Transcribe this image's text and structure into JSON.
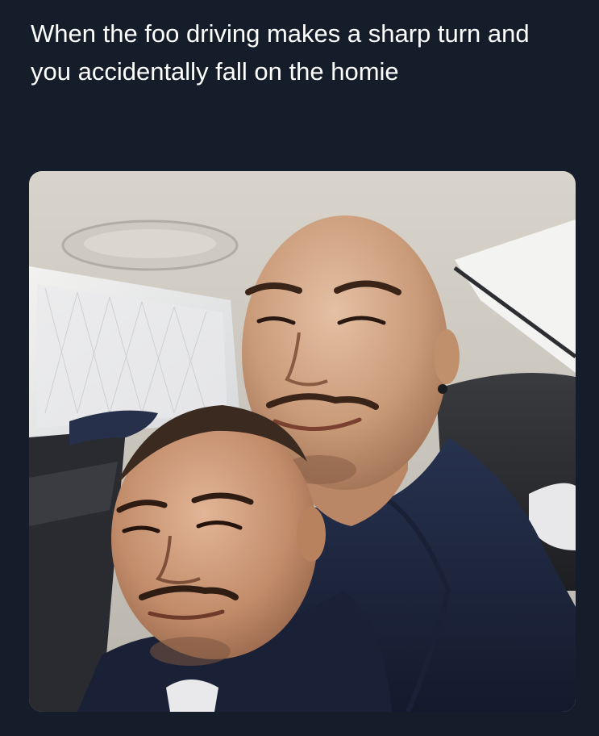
{
  "tweet": {
    "text": "When the foo driving makes a sharp turn and you accidentally fall on the homie"
  },
  "colors": {
    "background": "#151d2b",
    "text": "#ffffff"
  },
  "media": {
    "type": "photo",
    "description_icon": "selfie-photo-icon"
  }
}
